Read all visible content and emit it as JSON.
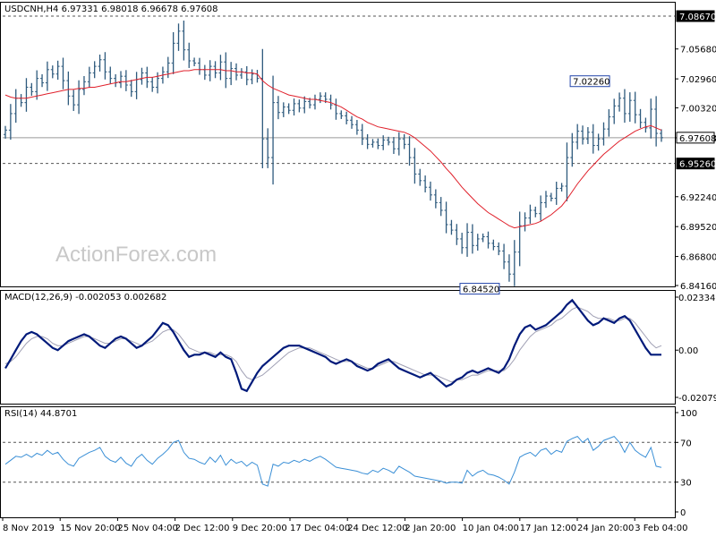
{
  "chart_data": {
    "type": "candlestick",
    "symbol_title": "USDCNH,H4  6.97331 6.98018 6.96678 6.97608",
    "watermark": "ActionForex.com",
    "x_tick_labels": [
      "8 Nov 2019",
      "15 Nov 20:00",
      "25 Nov 04:00",
      "2 Dec 12:00",
      "9 Dec 20:00",
      "17 Dec 04:00",
      "24 Dec 12:00",
      "2 Jan 20:00",
      "10 Jan 04:00",
      "17 Jan 12:00",
      "24 Jan 20:00",
      "3 Feb 04:00"
    ],
    "price_panel": {
      "ylim": [
        6.8416,
        7.0867
      ],
      "y_ticks": [
        {
          "value": 7.0568,
          "label": "7.05680"
        },
        {
          "value": 7.0296,
          "label": "7.02960"
        },
        {
          "value": 7.0032,
          "label": "7.00320"
        },
        {
          "value": 6.976,
          "label": "6.97600"
        },
        {
          "value": 6.9224,
          "label": "6.92240"
        },
        {
          "value": 6.8952,
          "label": "6.89520"
        },
        {
          "value": 6.868,
          "label": "6.86800"
        },
        {
          "value": 6.8416,
          "label": "6.84160"
        }
      ],
      "price_tags": [
        {
          "value": 7.0867,
          "label": "7.08670",
          "style": "dashed",
          "kind": "level"
        },
        {
          "value": 6.97608,
          "label": "6.97608",
          "style": "solid",
          "kind": "current"
        },
        {
          "value": 6.9526,
          "label": "6.95260",
          "style": "dashed",
          "kind": "level"
        }
      ],
      "annotations": [
        {
          "label": "7.02260",
          "value": 7.0226,
          "index": 117,
          "position": "above"
        },
        {
          "label": "6.84520",
          "value": 6.8452,
          "index": 96,
          "position": "below"
        }
      ],
      "close": [
        6.983,
        6.998,
        7.012,
        7.008,
        7.022,
        7.018,
        7.03,
        7.026,
        7.038,
        7.034,
        7.041,
        7.028,
        7.014,
        7.006,
        7.02,
        7.027,
        7.035,
        7.041,
        7.047,
        7.036,
        7.03,
        7.026,
        7.032,
        7.024,
        7.018,
        7.029,
        7.035,
        7.027,
        7.022,
        7.03,
        7.036,
        7.044,
        7.062,
        7.073,
        7.056,
        7.046,
        7.044,
        7.038,
        7.033,
        7.041,
        7.035,
        7.045,
        7.03,
        7.039,
        7.033,
        7.036,
        7.029,
        7.034,
        7.03,
        6.975,
        6.958,
        7.008,
        6.999,
        7.004,
        7.001,
        7.007,
        7.003,
        7.009,
        7.006,
        7.011,
        7.014,
        7.011,
        7.006,
        6.998,
        6.996,
        6.992,
        6.988,
        6.983,
        6.975,
        6.97,
        6.972,
        6.969,
        6.974,
        6.972,
        6.966,
        6.975,
        6.97,
        6.958,
        6.943,
        6.937,
        6.931,
        6.924,
        6.917,
        6.91,
        6.897,
        6.892,
        6.884,
        6.876,
        6.89,
        6.878,
        6.884,
        6.886,
        6.88,
        6.877,
        6.873,
        6.863,
        6.852,
        6.872,
        6.896,
        6.903,
        6.91,
        6.907,
        6.917,
        6.923,
        6.921,
        6.93,
        6.932,
        6.958,
        6.972,
        6.982,
        6.975,
        6.981,
        6.969,
        6.975,
        6.984,
        6.995,
        7.005,
        7.012,
        6.998,
        7.01,
        6.997,
        6.99,
        6.985,
        7.002,
        6.98,
        6.97608
      ],
      "ma": {
        "label": "",
        "color": "#e0202b",
        "values": [
          7.015,
          7.013,
          7.012,
          7.012,
          7.012,
          7.013,
          7.014,
          7.015,
          7.016,
          7.017,
          7.018,
          7.019,
          7.02,
          7.02,
          7.021,
          7.021,
          7.022,
          7.022,
          7.023,
          7.024,
          7.025,
          7.026,
          7.027,
          7.027,
          7.028,
          7.029,
          7.03,
          7.031,
          7.031,
          7.032,
          7.033,
          7.034,
          7.035,
          7.036,
          7.037,
          7.037,
          7.038,
          7.038,
          7.038,
          7.038,
          7.038,
          7.038,
          7.037,
          7.037,
          7.036,
          7.036,
          7.035,
          7.035,
          7.034,
          7.028,
          7.024,
          7.021,
          7.019,
          7.017,
          7.015,
          7.014,
          7.013,
          7.012,
          7.011,
          7.011,
          7.01,
          7.009,
          7.008,
          7.006,
          7.004,
          7.001,
          6.998,
          6.995,
          6.993,
          6.99,
          6.988,
          6.986,
          6.985,
          6.984,
          6.983,
          6.982,
          6.981,
          6.979,
          6.976,
          6.972,
          6.968,
          6.964,
          6.959,
          6.954,
          6.948,
          6.943,
          6.937,
          6.931,
          6.926,
          6.921,
          6.916,
          6.912,
          6.908,
          6.905,
          6.902,
          6.899,
          6.896,
          6.894,
          6.895,
          6.896,
          6.897,
          6.898,
          6.9,
          6.903,
          6.906,
          6.91,
          6.914,
          6.92,
          6.927,
          6.934,
          6.94,
          6.946,
          6.951,
          6.956,
          6.961,
          6.965,
          6.969,
          6.973,
          6.976,
          6.979,
          6.982,
          6.984,
          6.986,
          6.987,
          6.985,
          6.983
        ]
      }
    },
    "macd_panel": {
      "title": "MACD(12,26,9) -0.002053 0.002682",
      "ylim": [
        -0.020798,
        0.023345
      ],
      "y_ticks": [
        {
          "value": 0.023345,
          "label": "0.023345"
        },
        {
          "value": 0.0,
          "label": "0.00"
        },
        {
          "value": -0.020798,
          "label": "-0.020798"
        }
      ],
      "main": [
        -0.008,
        -0.004,
        0.0,
        0.004,
        0.007,
        0.008,
        0.007,
        0.005,
        0.003,
        0.001,
        0.0,
        0.002,
        0.004,
        0.005,
        0.006,
        0.007,
        0.006,
        0.004,
        0.002,
        0.001,
        0.003,
        0.005,
        0.006,
        0.005,
        0.003,
        0.001,
        0.002,
        0.004,
        0.006,
        0.009,
        0.012,
        0.011,
        0.008,
        0.004,
        0.0,
        -0.003,
        -0.002,
        -0.002,
        -0.001,
        -0.002,
        -0.003,
        -0.001,
        -0.003,
        -0.004,
        -0.01,
        -0.017,
        -0.018,
        -0.014,
        -0.01,
        -0.007,
        -0.005,
        -0.003,
        -0.001,
        0.001,
        0.002,
        0.002,
        0.002,
        0.001,
        0.0,
        -0.001,
        -0.002,
        -0.003,
        -0.005,
        -0.006,
        -0.005,
        -0.004,
        -0.005,
        -0.007,
        -0.008,
        -0.009,
        -0.008,
        -0.006,
        -0.005,
        -0.004,
        -0.006,
        -0.008,
        -0.009,
        -0.01,
        -0.011,
        -0.012,
        -0.011,
        -0.01,
        -0.012,
        -0.014,
        -0.016,
        -0.015,
        -0.013,
        -0.012,
        -0.01,
        -0.009,
        -0.01,
        -0.009,
        -0.008,
        -0.009,
        -0.01,
        -0.008,
        -0.004,
        0.002,
        0.007,
        0.01,
        0.011,
        0.009,
        0.01,
        0.011,
        0.013,
        0.015,
        0.017,
        0.02,
        0.022,
        0.019,
        0.016,
        0.013,
        0.011,
        0.012,
        0.014,
        0.013,
        0.012,
        0.014,
        0.015,
        0.013,
        0.009,
        0.005,
        0.001,
        -0.002,
        -0.002,
        -0.002
      ],
      "signal": [
        -0.006,
        -0.005,
        -0.003,
        0.0,
        0.003,
        0.005,
        0.006,
        0.006,
        0.005,
        0.003,
        0.002,
        0.002,
        0.003,
        0.004,
        0.005,
        0.006,
        0.006,
        0.005,
        0.004,
        0.003,
        0.003,
        0.004,
        0.005,
        0.005,
        0.004,
        0.003,
        0.002,
        0.003,
        0.004,
        0.006,
        0.008,
        0.009,
        0.009,
        0.007,
        0.004,
        0.001,
        0.0,
        -0.001,
        -0.001,
        -0.001,
        -0.002,
        -0.002,
        -0.002,
        -0.003,
        -0.005,
        -0.009,
        -0.012,
        -0.013,
        -0.012,
        -0.011,
        -0.009,
        -0.007,
        -0.005,
        -0.003,
        -0.001,
        0.0,
        0.001,
        0.001,
        0.001,
        0.0,
        -0.001,
        -0.002,
        -0.003,
        -0.004,
        -0.005,
        -0.005,
        -0.005,
        -0.006,
        -0.007,
        -0.008,
        -0.008,
        -0.007,
        -0.006,
        -0.005,
        -0.005,
        -0.006,
        -0.007,
        -0.008,
        -0.009,
        -0.01,
        -0.011,
        -0.011,
        -0.011,
        -0.012,
        -0.013,
        -0.014,
        -0.013,
        -0.013,
        -0.012,
        -0.011,
        -0.011,
        -0.01,
        -0.009,
        -0.009,
        -0.009,
        -0.009,
        -0.007,
        -0.004,
        0.0,
        0.003,
        0.006,
        0.008,
        0.009,
        0.01,
        0.011,
        0.013,
        0.014,
        0.016,
        0.018,
        0.019,
        0.018,
        0.017,
        0.015,
        0.014,
        0.014,
        0.014,
        0.013,
        0.013,
        0.014,
        0.014,
        0.012,
        0.009,
        0.006,
        0.003,
        0.001,
        0.002
      ]
    },
    "rsi_panel": {
      "title": "RSI(14) 44.8701",
      "ylim": [
        0,
        100
      ],
      "y_ticks": [
        {
          "value": 100,
          "label": "100"
        },
        {
          "value": 70,
          "label": "70"
        },
        {
          "value": 30,
          "label": "30"
        },
        {
          "value": 0,
          "label": "0"
        }
      ],
      "levels": [
        70,
        30
      ],
      "values": [
        48,
        52,
        56,
        55,
        58,
        55,
        59,
        57,
        62,
        58,
        60,
        53,
        48,
        46,
        54,
        57,
        60,
        62,
        65,
        56,
        52,
        50,
        55,
        49,
        46,
        54,
        58,
        52,
        48,
        54,
        58,
        63,
        70,
        72,
        60,
        54,
        53,
        50,
        48,
        55,
        50,
        57,
        47,
        53,
        49,
        51,
        46,
        50,
        47,
        28,
        26,
        48,
        46,
        50,
        49,
        52,
        50,
        53,
        51,
        54,
        56,
        53,
        49,
        45,
        44,
        43,
        42,
        41,
        39,
        38,
        42,
        40,
        44,
        42,
        39,
        46,
        43,
        40,
        36,
        35,
        34,
        33,
        32,
        31,
        29,
        30,
        30,
        29,
        42,
        36,
        40,
        42,
        38,
        37,
        35,
        32,
        28,
        40,
        55,
        58,
        60,
        56,
        62,
        64,
        58,
        62,
        60,
        71,
        74,
        76,
        70,
        74,
        62,
        66,
        72,
        74,
        76,
        70,
        60,
        70,
        62,
        58,
        55,
        65,
        46,
        44.87
      ]
    },
    "colors": {
      "candle": "#2e5a7d",
      "ma": "#e0202b",
      "macd_main": "#001a7a",
      "macd_signal": "#a0a0b4",
      "rsi": "#3a8fd6",
      "grid_dash": "#555555"
    }
  }
}
